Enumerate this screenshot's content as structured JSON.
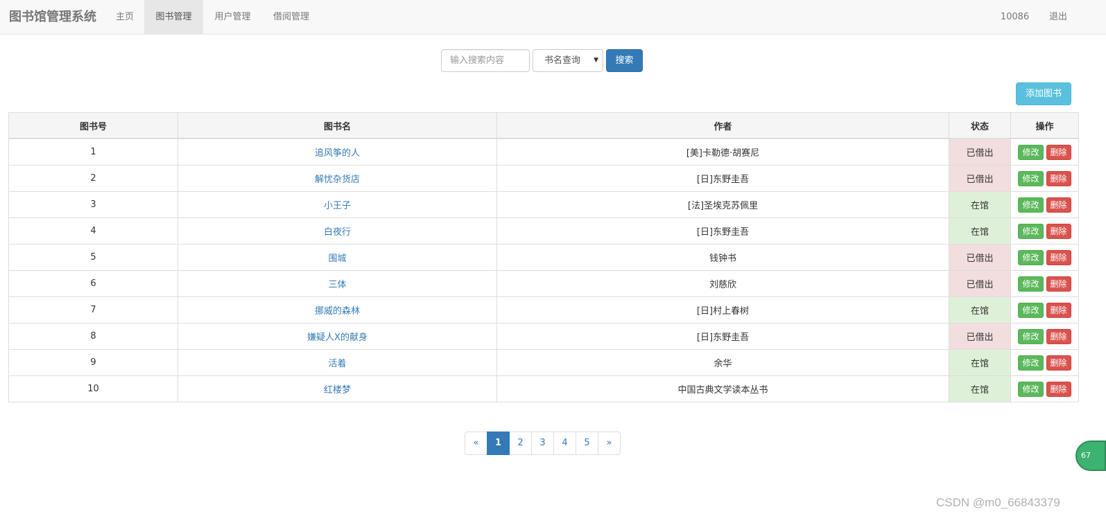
{
  "navbar": {
    "brand": "图书馆管理系统",
    "items": [
      {
        "label": "主页",
        "active": false
      },
      {
        "label": "图书管理",
        "active": true
      },
      {
        "label": "用户管理",
        "active": false
      },
      {
        "label": "借阅管理",
        "active": false
      }
    ],
    "user_id": "10086",
    "logout": "退出"
  },
  "search": {
    "placeholder": "输入搜索内容",
    "value": "",
    "type_selected": "书名查询",
    "button": "搜索"
  },
  "add_button": "添加图书",
  "table": {
    "headers": [
      "图书号",
      "图书名",
      "作者",
      "状态",
      "操作"
    ],
    "rows": [
      {
        "id": "1",
        "title": "追风筝的人",
        "author": "[美]卡勒德·胡赛尼",
        "status": "已借出",
        "lent": true
      },
      {
        "id": "2",
        "title": "解忧杂货店",
        "author": "[日]东野圭吾",
        "status": "已借出",
        "lent": true
      },
      {
        "id": "3",
        "title": "小王子",
        "author": "[法]圣埃克苏佩里",
        "status": "在馆",
        "lent": false
      },
      {
        "id": "4",
        "title": "白夜行",
        "author": "[日]东野圭吾",
        "status": "在馆",
        "lent": false
      },
      {
        "id": "5",
        "title": "围城",
        "author": "钱钟书",
        "status": "已借出",
        "lent": true
      },
      {
        "id": "6",
        "title": "三体",
        "author": "刘慈欣",
        "status": "已借出",
        "lent": true
      },
      {
        "id": "7",
        "title": "挪威的森林",
        "author": "[日]村上春树",
        "status": "在馆",
        "lent": false
      },
      {
        "id": "8",
        "title": "嫌疑人X的献身",
        "author": "[日]东野圭吾",
        "status": "已借出",
        "lent": true
      },
      {
        "id": "9",
        "title": "活着",
        "author": "余华",
        "status": "在馆",
        "lent": false
      },
      {
        "id": "10",
        "title": "红楼梦",
        "author": "中国古典文学读本丛书",
        "status": "在馆",
        "lent": false
      }
    ],
    "edit_label": "修改",
    "delete_label": "删除"
  },
  "pagination": {
    "prev": "«",
    "pages": [
      "1",
      "2",
      "3",
      "4",
      "5"
    ],
    "current": "1",
    "next": "»"
  },
  "float_badge": "67",
  "watermark": "CSDN @m0_66843379",
  "colors": {
    "primary": "#337ab7",
    "info": "#5bc0de",
    "success": "#5cb85c",
    "danger": "#d9534f",
    "lent_bg": "#f2dede",
    "available_bg": "#dff0d8"
  }
}
